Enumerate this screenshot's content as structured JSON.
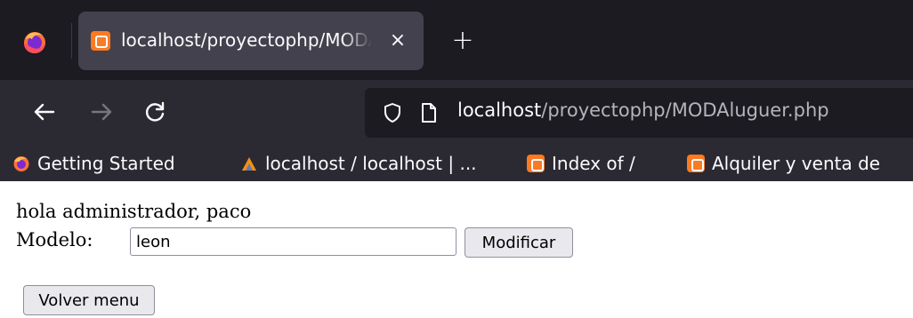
{
  "browser": {
    "tab": {
      "title": "localhost/proyectophp/MODAluguer.php",
      "close_glyph": "×",
      "favicon": "xampp-icon"
    },
    "new_tab_glyph": "+",
    "url": {
      "host": "localhost",
      "path": "/proyectophp/MODAluguer.php"
    },
    "bookmarks": [
      {
        "label": "Getting Started",
        "icon": "firefox-icon"
      },
      {
        "label": "localhost / localhost | ...",
        "icon": "phpmyadmin-icon"
      },
      {
        "label": "Index of /",
        "icon": "xampp-icon"
      },
      {
        "label": "Alquiler y venta de",
        "icon": "xampp-icon"
      }
    ],
    "colors": {
      "tab_strip": "#1c1b22",
      "toolbar": "#2b2a33",
      "active_tab": "#42414d",
      "xampp_orange": "#fb7a24"
    }
  },
  "page": {
    "greeting": "hola administrador, paco",
    "model_label": "Modelo:",
    "model_value": "leon",
    "modify_button": "Modificar",
    "back_button": "Volver menu"
  }
}
